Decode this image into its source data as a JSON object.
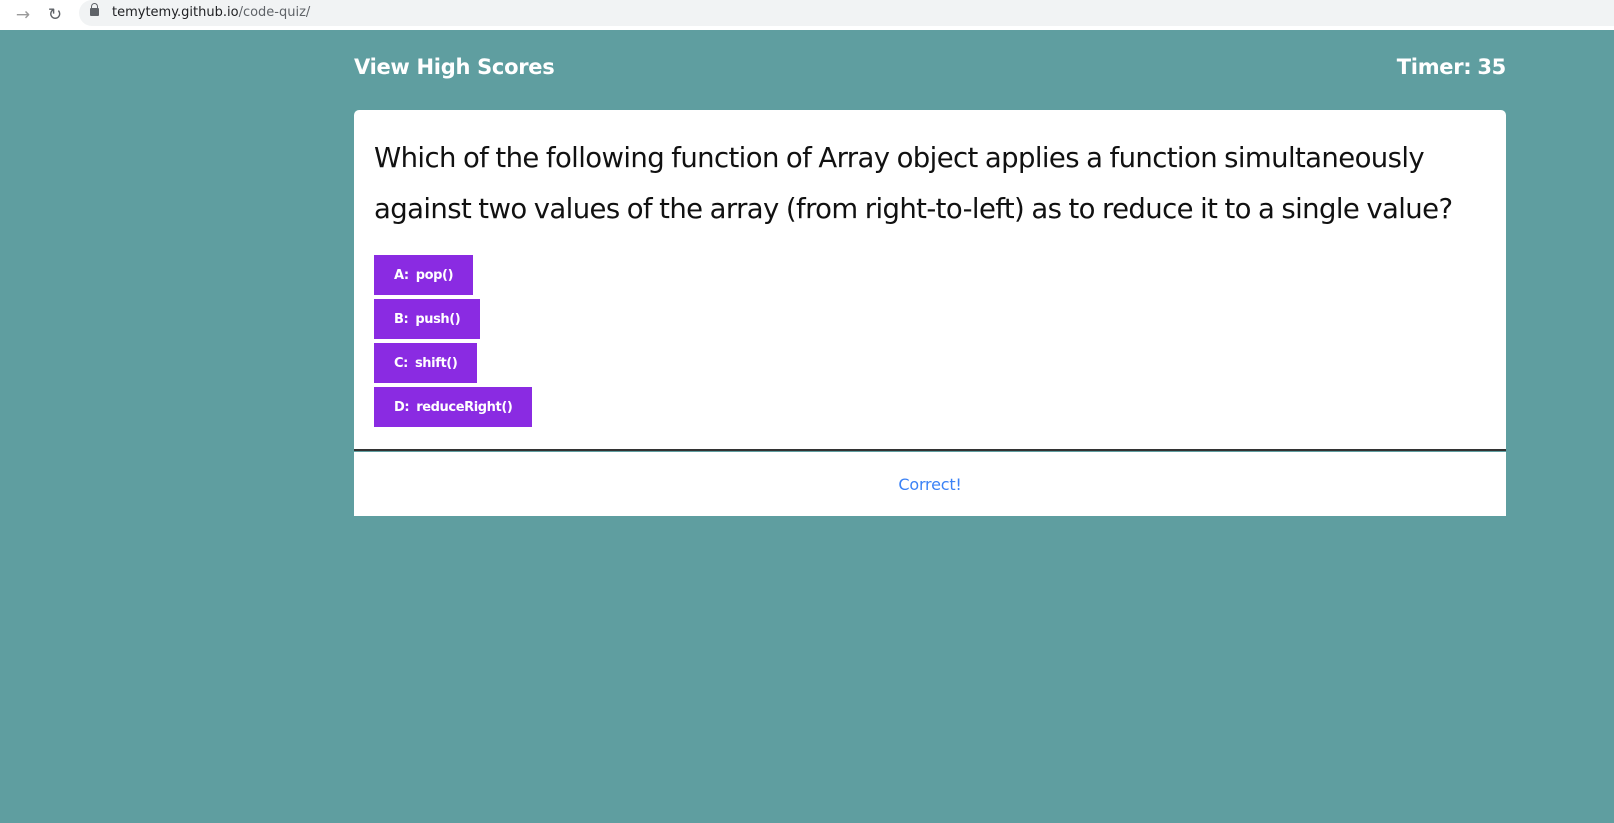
{
  "browser": {
    "url_host": "temytemy.github.io",
    "url_path": "/code-quiz/",
    "forward_icon": "→",
    "reload_icon": "↻"
  },
  "header": {
    "high_scores_label": "View High Scores",
    "timer_label": "Timer:",
    "timer_value": "35"
  },
  "quiz": {
    "question": "Which of the following function of Array object applies a function simultaneously against two values of the array (from right-to-left) as to reduce it to a single value?",
    "answers": [
      {
        "letter": "A:",
        "text": "pop()"
      },
      {
        "letter": "B:",
        "text": "push()"
      },
      {
        "letter": "C:",
        "text": "shift()"
      },
      {
        "letter": "D:",
        "text": "reduceRight()"
      }
    ]
  },
  "feedback": {
    "message": "Correct!"
  },
  "colors": {
    "background": "#5f9ea0",
    "answer_button": "#8a2be2",
    "feedback_text": "#3b82f6"
  }
}
